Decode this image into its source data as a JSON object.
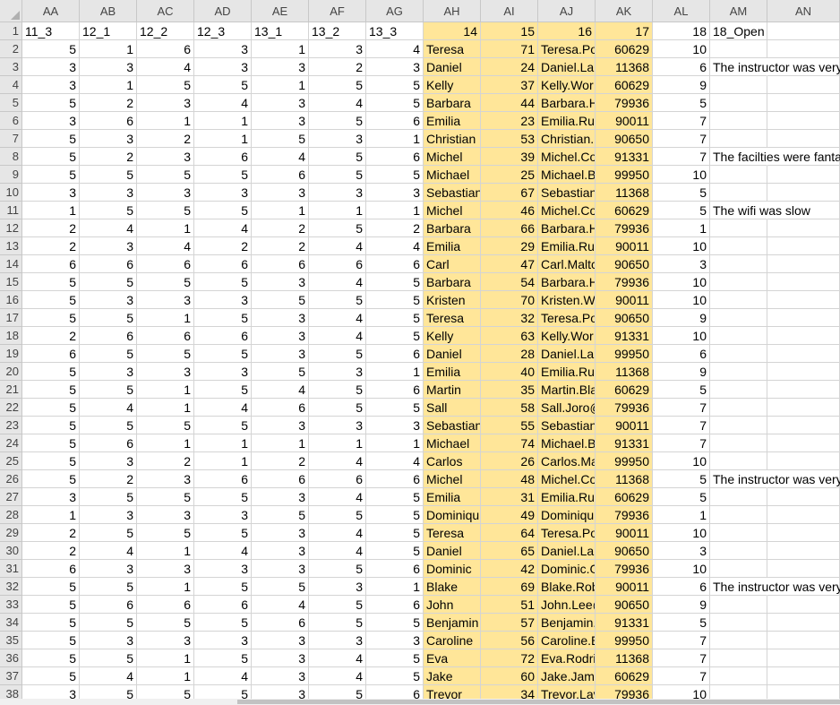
{
  "columns": [
    "AA",
    "AB",
    "AC",
    "AD",
    "AE",
    "AF",
    "AG",
    "AH",
    "AI",
    "AJ",
    "AK",
    "AL",
    "AM",
    "AN"
  ],
  "highlight_columns": [
    "AH",
    "AI",
    "AJ",
    "AK"
  ],
  "highlight_color": "#ffe699",
  "row_numbers": [
    "1",
    "2",
    "3",
    "4",
    "5",
    "6",
    "7",
    "8",
    "9",
    "10",
    "11",
    "12",
    "13",
    "14",
    "15",
    "16",
    "17",
    "18",
    "19",
    "20",
    "21",
    "22",
    "23",
    "24",
    "25",
    "26",
    "27",
    "28",
    "29",
    "30",
    "31",
    "32",
    "33",
    "34",
    "35",
    "36",
    "37",
    "38"
  ],
  "rows": [
    [
      "11_3",
      "12_1",
      "12_2",
      "12_3",
      "13_1",
      "13_2",
      "13_3",
      "14",
      "15",
      "16",
      "17",
      "18",
      "18_Open",
      ""
    ],
    [
      "5",
      "1",
      "6",
      "3",
      "1",
      "3",
      "4",
      "Teresa",
      "71",
      "Teresa.Po",
      "60629",
      "10",
      "",
      ""
    ],
    [
      "3",
      "3",
      "4",
      "3",
      "3",
      "2",
      "3",
      "Daniel",
      "24",
      "Daniel.Lar",
      "11368",
      "6",
      "The instructor was very",
      ""
    ],
    [
      "3",
      "1",
      "5",
      "5",
      "1",
      "5",
      "5",
      "Kelly",
      "37",
      "Kelly.Wor",
      "60629",
      "9",
      "",
      ""
    ],
    [
      "5",
      "2",
      "3",
      "4",
      "3",
      "4",
      "5",
      "Barbara",
      "44",
      "Barbara.H",
      "79936",
      "5",
      "",
      ""
    ],
    [
      "3",
      "6",
      "1",
      "1",
      "3",
      "5",
      "6",
      "Emilia",
      "23",
      "Emilia.Rui",
      "90011",
      "7",
      "",
      ""
    ],
    [
      "5",
      "3",
      "2",
      "1",
      "5",
      "3",
      "1",
      "Christian",
      "53",
      "Christian.I",
      "90650",
      "7",
      "",
      ""
    ],
    [
      "5",
      "2",
      "3",
      "6",
      "4",
      "5",
      "6",
      "Michel",
      "39",
      "Michel.Co",
      "91331",
      "7",
      "The facilties were fanta",
      ""
    ],
    [
      "5",
      "5",
      "5",
      "5",
      "6",
      "5",
      "5",
      "Michael",
      "25",
      "Michael.B",
      "99950",
      "10",
      "",
      ""
    ],
    [
      "3",
      "3",
      "3",
      "3",
      "3",
      "3",
      "3",
      "Sebastian",
      "67",
      "Sebastian",
      "11368",
      "5",
      "",
      ""
    ],
    [
      "1",
      "5",
      "5",
      "5",
      "1",
      "1",
      "1",
      "Michel",
      "46",
      "Michel.Co",
      "60629",
      "5",
      "The wifi was slow",
      ""
    ],
    [
      "2",
      "4",
      "1",
      "4",
      "2",
      "5",
      "2",
      "Barbara",
      "66",
      "Barbara.H",
      "79936",
      "1",
      "",
      ""
    ],
    [
      "2",
      "3",
      "4",
      "2",
      "2",
      "4",
      "4",
      "Emilia",
      "29",
      "Emilia.Rui",
      "90011",
      "10",
      "",
      ""
    ],
    [
      "6",
      "6",
      "6",
      "6",
      "6",
      "6",
      "6",
      "Carl",
      "47",
      "Carl.Maltc",
      "90650",
      "3",
      "",
      ""
    ],
    [
      "5",
      "5",
      "5",
      "5",
      "3",
      "4",
      "5",
      "Barbara",
      "54",
      "Barbara.H",
      "79936",
      "10",
      "",
      ""
    ],
    [
      "5",
      "3",
      "3",
      "3",
      "5",
      "5",
      "5",
      "Kristen",
      "70",
      "Kristen.W",
      "90011",
      "10",
      "",
      ""
    ],
    [
      "5",
      "5",
      "1",
      "5",
      "3",
      "4",
      "5",
      "Teresa",
      "32",
      "Teresa.Po",
      "90650",
      "9",
      "",
      ""
    ],
    [
      "2",
      "6",
      "6",
      "6",
      "3",
      "4",
      "5",
      "Kelly",
      "63",
      "Kelly.Wor",
      "91331",
      "10",
      "",
      ""
    ],
    [
      "6",
      "5",
      "5",
      "5",
      "3",
      "5",
      "6",
      "Daniel",
      "28",
      "Daniel.Lar",
      "99950",
      "6",
      "",
      ""
    ],
    [
      "5",
      "3",
      "3",
      "3",
      "5",
      "3",
      "1",
      "Emilia",
      "40",
      "Emilia.Rui",
      "11368",
      "9",
      "",
      ""
    ],
    [
      "5",
      "5",
      "1",
      "5",
      "4",
      "5",
      "6",
      "Martin",
      "35",
      "Martin.Bla",
      "60629",
      "5",
      "",
      ""
    ],
    [
      "5",
      "4",
      "1",
      "4",
      "6",
      "5",
      "5",
      "Sall",
      "58",
      "Sall.Joro@",
      "79936",
      "7",
      "",
      ""
    ],
    [
      "5",
      "5",
      "5",
      "5",
      "3",
      "3",
      "3",
      "Sebastian",
      "55",
      "Sebastian",
      "90011",
      "7",
      "",
      ""
    ],
    [
      "5",
      "6",
      "1",
      "1",
      "1",
      "1",
      "1",
      "Michael",
      "74",
      "Michael.B",
      "91331",
      "7",
      "",
      ""
    ],
    [
      "5",
      "3",
      "2",
      "1",
      "2",
      "4",
      "4",
      "Carlos",
      "26",
      "Carlos.Ma",
      "99950",
      "10",
      "",
      ""
    ],
    [
      "5",
      "2",
      "3",
      "6",
      "6",
      "6",
      "6",
      "Michel",
      "48",
      "Michel.Co",
      "11368",
      "5",
      "The instructor was very",
      ""
    ],
    [
      "3",
      "5",
      "5",
      "5",
      "3",
      "4",
      "5",
      "Emilia",
      "31",
      "Emilia.Rui",
      "60629",
      "5",
      "",
      ""
    ],
    [
      "1",
      "3",
      "3",
      "3",
      "5",
      "5",
      "5",
      "Dominiqu",
      "49",
      "Dominiqu",
      "79936",
      "1",
      "",
      ""
    ],
    [
      "2",
      "5",
      "5",
      "5",
      "3",
      "4",
      "5",
      "Teresa",
      "64",
      "Teresa.Po",
      "90011",
      "10",
      "",
      ""
    ],
    [
      "2",
      "4",
      "1",
      "4",
      "3",
      "4",
      "5",
      "Daniel",
      "65",
      "Daniel.Lar",
      "90650",
      "3",
      "",
      ""
    ],
    [
      "6",
      "3",
      "3",
      "3",
      "3",
      "5",
      "6",
      "Dominic",
      "42",
      "Dominic.G",
      "79936",
      "10",
      "",
      ""
    ],
    [
      "5",
      "5",
      "1",
      "5",
      "5",
      "3",
      "1",
      "Blake",
      "69",
      "Blake.Rob",
      "90011",
      "6",
      "The instructor was very",
      ""
    ],
    [
      "5",
      "6",
      "6",
      "6",
      "4",
      "5",
      "6",
      "John",
      "51",
      "John.Lee@",
      "90650",
      "9",
      "",
      ""
    ],
    [
      "5",
      "5",
      "5",
      "5",
      "6",
      "5",
      "5",
      "Benjamin",
      "57",
      "Benjamin.",
      "91331",
      "5",
      "",
      ""
    ],
    [
      "5",
      "3",
      "3",
      "3",
      "3",
      "3",
      "3",
      "Caroline",
      "56",
      "Caroline.E",
      "99950",
      "7",
      "",
      ""
    ],
    [
      "5",
      "5",
      "1",
      "5",
      "3",
      "4",
      "5",
      "Eva",
      "72",
      "Eva.Rodrig",
      "11368",
      "7",
      "",
      ""
    ],
    [
      "5",
      "4",
      "1",
      "4",
      "3",
      "4",
      "5",
      "Jake",
      "60",
      "Jake.Jame",
      "60629",
      "7",
      "",
      ""
    ],
    [
      "3",
      "5",
      "5",
      "5",
      "3",
      "5",
      "6",
      "Trevor",
      "34",
      "Trevor.Lav",
      "79936",
      "10",
      "",
      ""
    ]
  ]
}
